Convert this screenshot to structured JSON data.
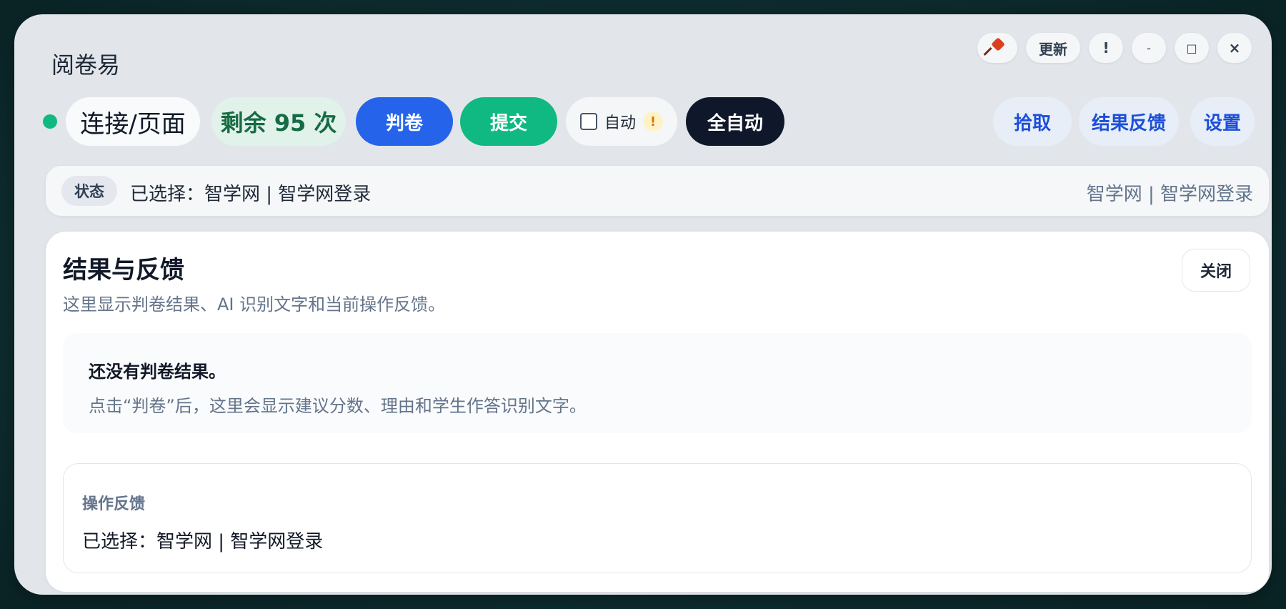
{
  "app": {
    "title": "阅卷易"
  },
  "window_controls": {
    "update_label": "更新",
    "alert_label": "!",
    "minimize_label": "-",
    "maximize_label": "□",
    "close_label": "×"
  },
  "toolbar": {
    "connection_label": "连接/页面",
    "remaining_label": "剩余 95 次",
    "grade_label": "判卷",
    "submit_label": "提交",
    "auto_label": "自动",
    "auto_checked": false,
    "auto_warning": "!",
    "full_auto_label": "全自动",
    "pick_label": "拾取",
    "feedback_label": "结果反馈",
    "settings_label": "设置"
  },
  "status": {
    "tag": "状态",
    "text": "已选择：智学网 | 智学网登录",
    "right_text": "智学网 | 智学网登录"
  },
  "panel": {
    "title": "结果与反馈",
    "subtitle": "这里显示判卷结果、AI 识别文字和当前操作反馈。",
    "close_label": "关闭",
    "empty_title": "还没有判卷结果。",
    "empty_desc": "点击“判卷”后，这里会显示建议分数、理由和学生作答识别文字。",
    "feedback_label": "操作反馈",
    "feedback_text": "已选择：智学网 | 智学网登录"
  },
  "colors": {
    "status_dot": "#10b981",
    "grade_button": "#2563eb",
    "submit_button": "#10b981",
    "full_auto_button": "#0f172a"
  },
  "icons": {
    "pin": "pin-icon",
    "check": "checkbox-icon",
    "warning": "warning-icon"
  }
}
